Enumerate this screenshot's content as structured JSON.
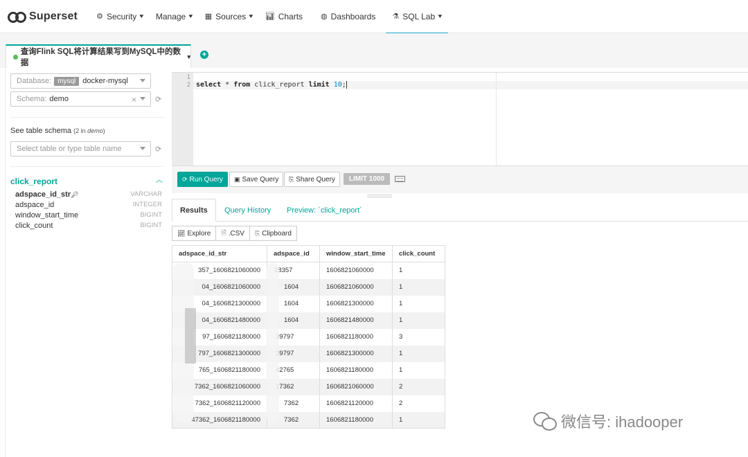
{
  "nav": {
    "brand": "Superset",
    "items": [
      {
        "label": "Security",
        "icon": "gear-icon",
        "dropdown": true
      },
      {
        "label": "Manage",
        "icon": "",
        "dropdown": true
      },
      {
        "label": "Sources",
        "icon": "table-icon",
        "dropdown": true
      },
      {
        "label": "Charts",
        "icon": "bar-chart-icon",
        "dropdown": false
      },
      {
        "label": "Dashboards",
        "icon": "dashboard-icon",
        "dropdown": false
      },
      {
        "label": "SQL Lab",
        "icon": "flask-icon",
        "dropdown": true,
        "active": true
      }
    ]
  },
  "query_tab": {
    "title": "查询Flink SQL将计算结果写到MySQL中的数据",
    "add_symbol": "+"
  },
  "left": {
    "database": {
      "label": "Database:",
      "engine": "mysql",
      "name": "docker-mysql"
    },
    "schema": {
      "label": "Schema:",
      "value": "demo"
    },
    "see_schema": {
      "text": "See table schema",
      "count": "(2 in ",
      "schema": "demo",
      "close": ")"
    },
    "table_select": {
      "placeholder": "Select table or type table name"
    },
    "table": {
      "name": "click_report",
      "columns": [
        {
          "name": "adspace_id_str",
          "type": "VARCHAR",
          "key": true
        },
        {
          "name": "adspace_id",
          "type": "INTEGER",
          "key": false
        },
        {
          "name": "window_start_time",
          "type": "BIGINT",
          "key": false
        },
        {
          "name": "click_count",
          "type": "BIGINT",
          "key": false
        }
      ]
    }
  },
  "editor": {
    "line_numbers": [
      "1",
      "2"
    ],
    "sql": {
      "kw1": "select",
      "mid1": " * ",
      "kw2": "from",
      "mid2": " click_report ",
      "kw3": "limit",
      "num": "10",
      "tail": ";"
    }
  },
  "toolbar": {
    "run": "Run Query",
    "save": "Save Query",
    "share": "Share Query",
    "limit": "LIMIT 1000"
  },
  "results": {
    "tabs": [
      "Results",
      "Query History",
      "Preview: `click_report`"
    ],
    "actions": [
      "Explore",
      ".CSV",
      "Clipboard"
    ],
    "columns": [
      "adspace_id_str",
      "adspace_id",
      "window_start_time",
      "click_count"
    ],
    "rows": [
      [
        "357_1606821060000",
        "28357",
        "1606821060000",
        "1"
      ],
      [
        "04_1606821060000",
        "1604",
        "1606821060000",
        "1"
      ],
      [
        "04_1606821300000",
        "1604",
        "1606821300000",
        "1"
      ],
      [
        "04_1606821480000",
        "1604",
        "1606821480000",
        "1"
      ],
      [
        "97_1606821180000",
        "39797",
        "1606821180000",
        "3"
      ],
      [
        "797_1606821300000",
        "39797",
        "1606821300000",
        "1"
      ],
      [
        "765_1606821180000",
        "42765",
        "1606821180000",
        "1"
      ],
      [
        "7362_1606821060000",
        "17362",
        "1606821060000",
        "2"
      ],
      [
        "7362_1606821120000",
        "7362",
        "1606821120000",
        "2"
      ],
      [
        "47362_1606821180000",
        "7362",
        "1606821180000",
        "1"
      ]
    ]
  },
  "watermark": "微信号: ihadooper"
}
